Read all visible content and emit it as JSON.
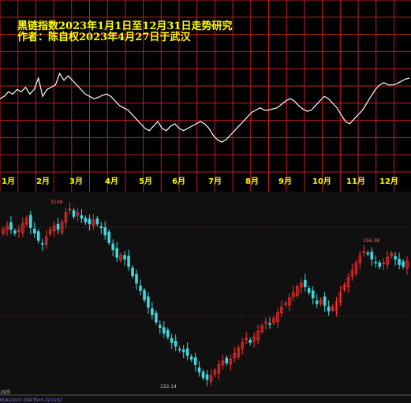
{
  "colors": {
    "grid": "#c02020",
    "upline": "#ffffff",
    "title": "#ffff00",
    "up": "#ff3030",
    "down": "#40d8e0",
    "lower_bg": "#101010"
  },
  "header": {
    "title": "黑链指数2023年1月1日至12月31日走势研究",
    "author": "作者：陈自权2023年4月27日于武汉"
  },
  "chart_data": [
    {
      "type": "line",
      "title": "黑链指数2023年1月1日至12月31日走势研究",
      "categories": [
        "1月",
        "2月",
        "3月",
        "4月",
        "5月",
        "6月",
        "7月",
        "8月",
        "9月",
        "10月",
        "11月",
        "12月"
      ],
      "ylim": [
        0,
        100
      ],
      "grid": true,
      "series": [
        {
          "values": [
            62,
            64,
            68,
            66,
            70,
            68,
            72,
            66,
            70,
            80,
            64,
            70,
            72,
            74,
            84,
            78,
            82,
            78,
            74,
            70,
            66,
            64,
            62,
            63,
            65,
            66,
            64,
            60,
            56,
            54,
            52,
            48,
            44,
            40,
            36,
            34,
            38,
            42,
            36,
            34,
            38,
            40,
            36,
            34,
            36,
            38,
            40,
            42,
            40,
            36,
            30,
            26,
            24,
            26,
            30,
            34,
            38,
            42,
            46,
            50,
            52,
            54,
            52,
            52,
            53,
            54,
            57,
            60,
            62,
            60,
            56,
            53,
            51,
            52,
            56,
            60,
            64,
            62,
            58,
            54,
            48,
            42,
            40,
            44,
            48,
            52,
            58,
            64,
            70,
            74,
            76,
            74,
            74,
            75,
            77,
            79,
            80
          ]
        }
      ]
    },
    {
      "type": "candlestick",
      "annotations": [
        "3149",
        "122.14",
        "156.38"
      ],
      "series": [
        {
          "name": "close",
          "values": [
            86,
            88,
            86,
            84,
            86,
            89,
            92,
            87,
            84,
            80,
            78,
            82,
            86,
            88,
            86,
            90,
            95,
            97,
            93,
            95,
            92,
            90,
            89,
            91,
            89,
            87,
            83,
            79,
            75,
            71,
            72,
            70,
            66,
            61,
            57,
            53,
            48,
            44,
            40,
            36,
            33,
            30,
            28,
            25,
            23,
            21,
            20,
            18,
            16,
            13,
            9,
            6,
            5,
            7,
            10,
            13,
            15,
            14,
            16,
            19,
            22,
            25,
            27,
            25,
            28,
            31,
            34,
            36,
            35,
            38,
            41,
            44,
            46,
            49,
            52,
            55,
            57,
            55,
            52,
            49,
            46,
            48,
            45,
            42,
            44,
            47,
            52,
            56,
            60,
            64,
            68,
            72,
            74,
            73,
            70,
            68,
            66,
            68,
            71,
            73,
            70,
            67,
            66,
            69
          ]
        }
      ]
    }
  ],
  "top_chart": {
    "month_labels": [
      "1月",
      "2月",
      "3月",
      "4月",
      "5月",
      "6月",
      "7月",
      "8月",
      "9月",
      "10月",
      "11月",
      "12月"
    ]
  },
  "kline": {
    "high_label": "3149",
    "low_label": "122.14",
    "right_label": "156.38",
    "left_label": "2成员",
    "footer": "6DA1/2/23 .CUR:TS=5-22.11%T"
  }
}
